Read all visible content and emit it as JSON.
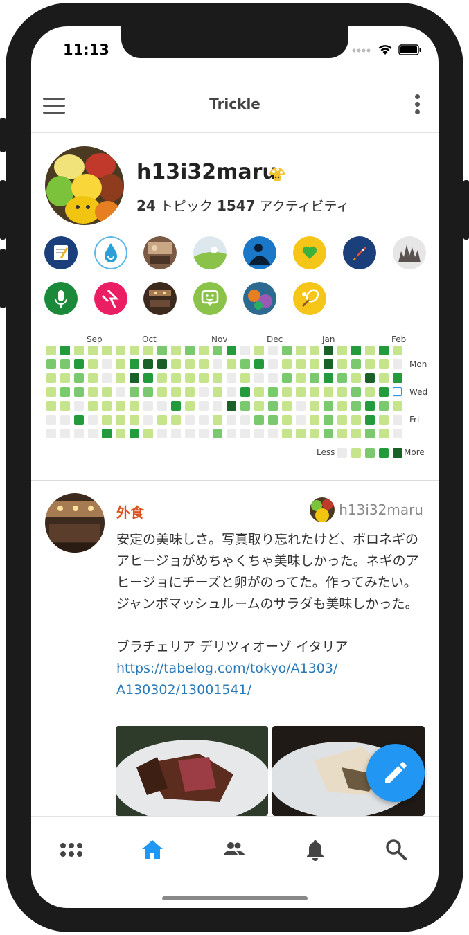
{
  "status_bar": {
    "time": "11:13"
  },
  "app_bar": {
    "title": "Trickle",
    "menu_icon": "hamburger-menu-icon",
    "more_icon": "vertical-dots-icon"
  },
  "profile": {
    "username": "h13i32maru",
    "badge_icon": "mushroom-icon",
    "topics_count": "24",
    "topics_label": " トピック ",
    "activity_count": "1547",
    "activity_label": " アクティビティ",
    "topic_icons": [
      "note-icon",
      "water-drop-icon",
      "room-photo",
      "field-photo",
      "reader-icon",
      "heart-icon",
      "rocket-icon",
      "castle-photo",
      "microphone-icon",
      "lightning-icon",
      "restaurant-photo",
      "chat-icon",
      "game-photo",
      "tennis-icon"
    ]
  },
  "activity": {
    "months": [
      "Sep",
      "Oct",
      "Nov",
      "Dec",
      "Jan",
      "Feb"
    ],
    "days": [
      "Mon",
      "Wed",
      "Fri"
    ],
    "legend_less": "Less",
    "legend_more": "More",
    "colors": [
      "#ebebeb",
      "#c6e48b",
      "#7bc96f",
      "#239a3b",
      "#196127"
    ],
    "grid": [
      [
        1,
        3,
        1,
        1,
        1,
        1,
        1,
        1,
        2,
        1,
        2,
        1,
        2,
        3,
        0,
        1,
        0,
        2,
        1,
        1,
        4,
        1,
        3,
        1,
        3,
        1
      ],
      [
        2,
        2,
        3,
        1,
        0,
        1,
        3,
        4,
        4,
        1,
        1,
        1,
        0,
        1,
        2,
        3,
        0,
        1,
        1,
        1,
        4,
        1,
        2,
        1,
        1,
        0
      ],
      [
        1,
        1,
        2,
        1,
        0,
        1,
        4,
        3,
        1,
        1,
        1,
        1,
        1,
        0,
        1,
        0,
        0,
        2,
        1,
        2,
        3,
        2,
        1,
        4,
        1,
        3
      ],
      [
        1,
        2,
        2,
        1,
        1,
        0,
        2,
        2,
        1,
        1,
        1,
        0,
        1,
        0,
        3,
        1,
        2,
        1,
        1,
        1,
        1,
        1,
        2,
        1,
        3,
        0
      ],
      [
        1,
        1,
        0,
        1,
        1,
        1,
        1,
        0,
        0,
        3,
        1,
        0,
        0,
        4,
        2,
        1,
        2,
        1,
        0,
        1,
        2,
        1,
        2,
        3,
        2,
        1
      ],
      [
        0,
        0,
        3,
        0,
        1,
        1,
        1,
        0,
        1,
        1,
        0,
        0,
        1,
        0,
        0,
        2,
        2,
        1,
        0,
        1,
        2,
        1,
        1,
        3,
        1,
        0
      ],
      [
        0,
        0,
        0,
        0,
        3,
        1,
        3,
        1,
        0,
        0,
        0,
        0,
        2,
        0,
        0,
        0,
        0,
        1,
        1,
        1,
        2,
        1,
        1,
        2,
        1,
        0
      ]
    ]
  },
  "post": {
    "topic": "外食",
    "author": "h13i32maru",
    "body": "安定の美味しさ。写真取り忘れたけど、ポロネギのアヒージョがめちゃくちゃ美味しかった。ネギのアヒージョにチーズと卵がのってた。作ってみたい。ジャンボマッシュルームのサラダも美味しかった。",
    "place": "ブラチェリア デリツィオーゾ イタリア",
    "link_line1": "https://tabelog.com/tokyo/A1303/",
    "link_line2": "A130302/13001541/"
  },
  "tab_bar": {
    "items": [
      "apps-icon",
      "home-icon",
      "people-icon",
      "bell-icon",
      "search-icon"
    ],
    "active": "home-icon"
  },
  "fab": {
    "icon": "pencil-icon"
  }
}
